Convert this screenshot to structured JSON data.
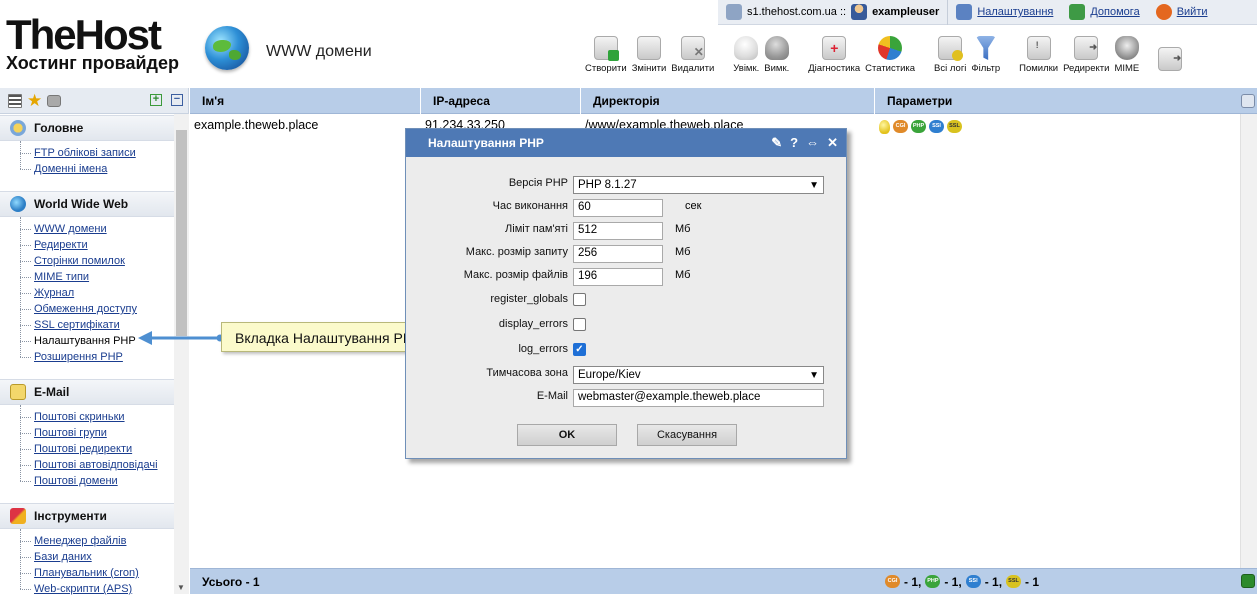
{
  "topbar": {
    "server": "s1.thehost.com.ua ::",
    "username": "exampleuser",
    "settings": "Налаштування",
    "help": "Допомога",
    "logout": "Вийти"
  },
  "brand": {
    "name": "TheHost",
    "tagline": "Хостинг провайдер"
  },
  "page_title": "WWW домени",
  "toolbar": [
    {
      "label": "Створити",
      "icon": "create-icon"
    },
    {
      "label": "Змінити",
      "icon": "edit-icon"
    },
    {
      "label": "Видалити",
      "icon": "delete-icon"
    },
    {
      "label": "Увімк.",
      "icon": "enable-bulb-icon"
    },
    {
      "label": "Вимк.",
      "icon": "disable-bulb-icon"
    },
    {
      "label": "Діагностика",
      "icon": "diagnostics-icon"
    },
    {
      "label": "Статистика",
      "icon": "statistics-icon"
    },
    {
      "label": "Всі логі",
      "icon": "logs-icon"
    },
    {
      "label": "Фільтр",
      "icon": "filter-icon"
    },
    {
      "label": "Помилки",
      "icon": "errors-icon"
    },
    {
      "label": "Редиректи",
      "icon": "redirects-icon"
    },
    {
      "label": "MIME",
      "icon": "mime-icon"
    }
  ],
  "sidebar": {
    "sections": [
      {
        "title": "Головне",
        "items": [
          "FTP облікові записи",
          "Доменні імена"
        ]
      },
      {
        "title": "World Wide Web",
        "items": [
          "WWW домени",
          "Редиректи",
          "Сторінки помилок",
          "MIME типи",
          "Журнал",
          "Обмеження доступу",
          "SSL сертифікати",
          "Налаштування PHP",
          "Розширення PHP"
        ]
      },
      {
        "title": "E-Mail",
        "items": [
          "Поштові скриньки",
          "Поштові групи",
          "Поштові редиректи",
          "Поштові автовідповідачі",
          "Поштові домени"
        ]
      },
      {
        "title": "Інструменти",
        "items": [
          "Менеджер файлів",
          "Бази даних",
          "Планувальник (cron)",
          "Web-скрипти (APS)"
        ]
      }
    ]
  },
  "table": {
    "headers": [
      "Ім'я",
      "IP-адреса",
      "Директорія",
      "Параметри"
    ],
    "row": {
      "name": "example.theweb.place",
      "ip": "91.234.33.250",
      "dir": "/www/example.theweb.place"
    },
    "footer_total": "Усього - 1",
    "footer_counts": [
      "- 1,",
      "- 1,",
      "- 1,",
      "- 1"
    ]
  },
  "dialog": {
    "title": "Налаштування PHP",
    "fields": {
      "php_version_label": "Версія PHP",
      "php_version": "PHP 8.1.27",
      "exec_time_label": "Час виконання",
      "exec_time": "60",
      "exec_time_unit": "сек",
      "memory_label": "Ліміт пам'яті",
      "memory": "512",
      "memory_unit": "Мб",
      "post_size_label": "Макс. розмір запиту",
      "post_size": "256",
      "post_size_unit": "Мб",
      "upload_size_label": "Макс. розмір файлів",
      "upload_size": "196",
      "upload_size_unit": "Мб",
      "register_globals_label": "register_globals",
      "display_errors_label": "display_errors",
      "log_errors_label": "log_errors",
      "timezone_label": "Тимчасова зона",
      "timezone": "Europe/Kiev",
      "email_label": "E-Mail",
      "email": "webmaster@example.theweb.place"
    },
    "ok": "OK",
    "cancel": "Скасування"
  },
  "callout": "Вкладка Налаштування PHP",
  "colors": {
    "header_blue": "#b8cde8",
    "dialog_title": "#4e79b5",
    "link": "#1a3d8f"
  }
}
